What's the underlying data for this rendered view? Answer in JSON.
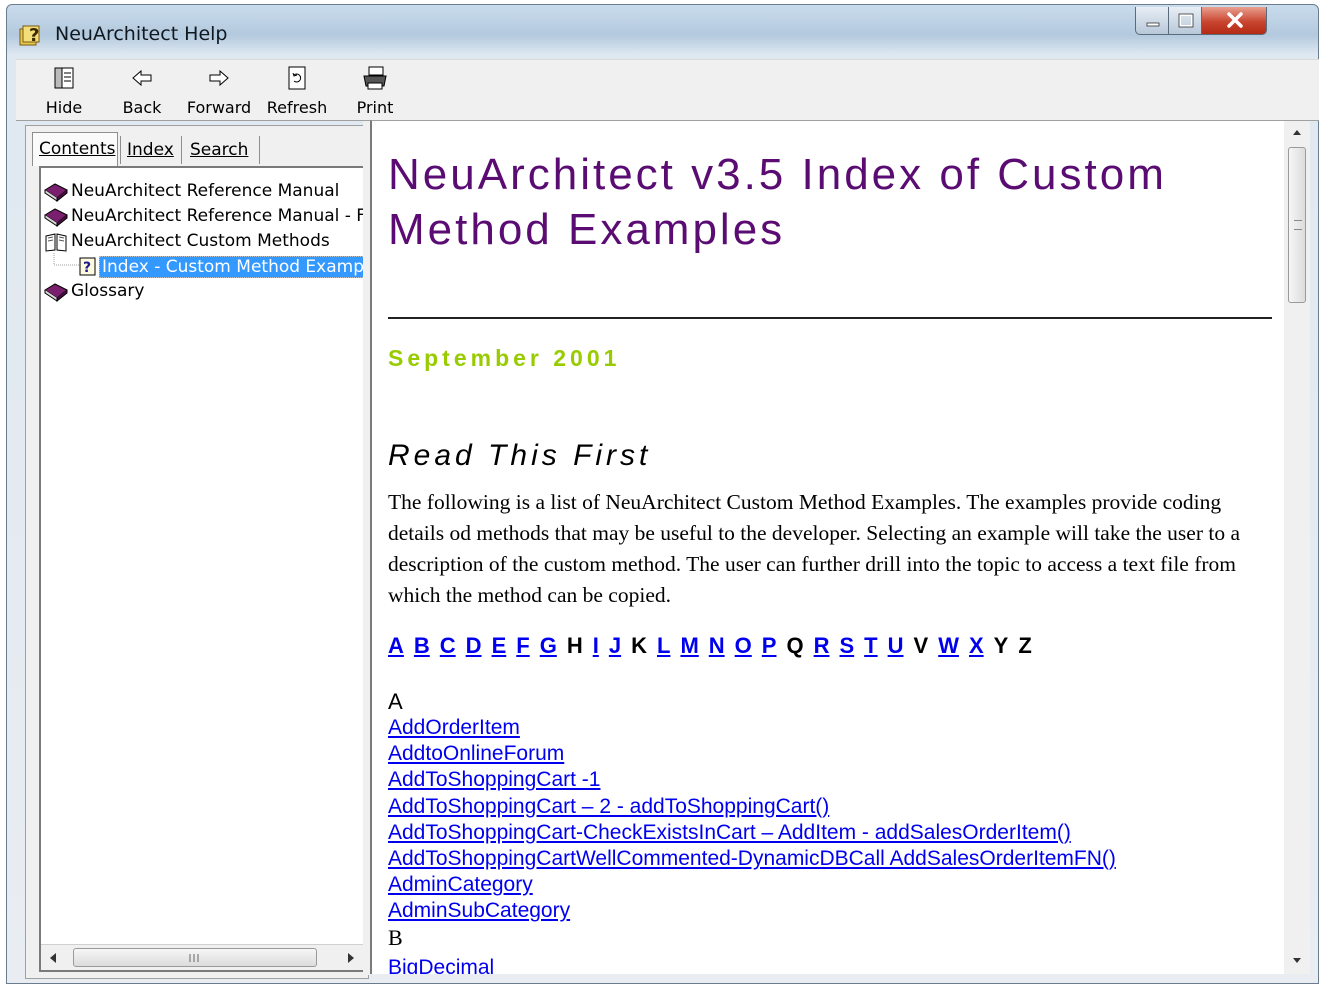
{
  "window": {
    "title": "NeuArchitect Help"
  },
  "toolbar": {
    "hide_label": "Hide",
    "back_label": "Back",
    "forward_label": "Forward",
    "refresh_label": "Refresh",
    "print_label": "Print"
  },
  "nav_tabs": {
    "contents": "Contents",
    "index": "Index",
    "search": "Search"
  },
  "tree": {
    "items": [
      {
        "label": "NeuArchitect Reference Manual",
        "icon": "closed-book-icon"
      },
      {
        "label": "NeuArchitect Reference Manual - F",
        "icon": "closed-book-icon"
      },
      {
        "label": "NeuArchitect Custom Methods",
        "icon": "open-book-icon"
      },
      {
        "label": "Index - Custom Method Examp",
        "icon": "help-page-icon",
        "selected": true
      },
      {
        "label": "Glossary",
        "icon": "closed-book-icon"
      }
    ]
  },
  "document": {
    "title": "NeuArchitect v3.5 Index of Custom Method Examples",
    "date": "September 2001",
    "section_heading": "Read This First",
    "intro": "The following is a list of NeuArchitect Custom Method Examples. The examples provide coding details od methods that may be useful to the developer.  Selecting an example will take the user to a description of the custom method.  The user can further drill into the topic to access a text file from which the method can be copied.",
    "alphabet": [
      {
        "letter": "A",
        "link": true
      },
      {
        "letter": "B",
        "link": true
      },
      {
        "letter": "C",
        "link": true
      },
      {
        "letter": "D",
        "link": true
      },
      {
        "letter": "E",
        "link": true
      },
      {
        "letter": "F",
        "link": true
      },
      {
        "letter": "G",
        "link": true
      },
      {
        "letter": "H",
        "link": false
      },
      {
        "letter": "I",
        "link": true
      },
      {
        "letter": "J",
        "link": true
      },
      {
        "letter": "K",
        "link": false
      },
      {
        "letter": "L",
        "link": true
      },
      {
        "letter": "M",
        "link": true
      },
      {
        "letter": "N",
        "link": true
      },
      {
        "letter": "O",
        "link": true
      },
      {
        "letter": "P",
        "link": true
      },
      {
        "letter": "Q",
        "link": false
      },
      {
        "letter": "R",
        "link": true
      },
      {
        "letter": "S",
        "link": true
      },
      {
        "letter": "T",
        "link": true
      },
      {
        "letter": "U",
        "link": true
      },
      {
        "letter": "V",
        "link": false
      },
      {
        "letter": "W",
        "link": true
      },
      {
        "letter": "X",
        "link": true
      },
      {
        "letter": "Y",
        "link": false
      },
      {
        "letter": "Z",
        "link": false
      }
    ],
    "section_a": {
      "heading": "A",
      "links": [
        "AddOrderItem",
        "AddtoOnlineForum",
        "AddToShoppingCart -1",
        "AddToShoppingCart – 2 - addToShoppingCart()",
        "AddToShoppingCart-CheckExistsInCart – AddItem - addSalesOrderItem()",
        "AddToShoppingCartWellCommented-DynamicDBCall  AddSalesOrderItemFN()",
        "AdminCategory",
        "AdminSubCategory"
      ]
    },
    "section_b": {
      "heading": "B",
      "links": [
        "BigDecimal"
      ]
    }
  },
  "colors": {
    "title": "#5a0c73",
    "date": "#99cc00",
    "link": "#0000ee",
    "selection": "#3399ff"
  }
}
